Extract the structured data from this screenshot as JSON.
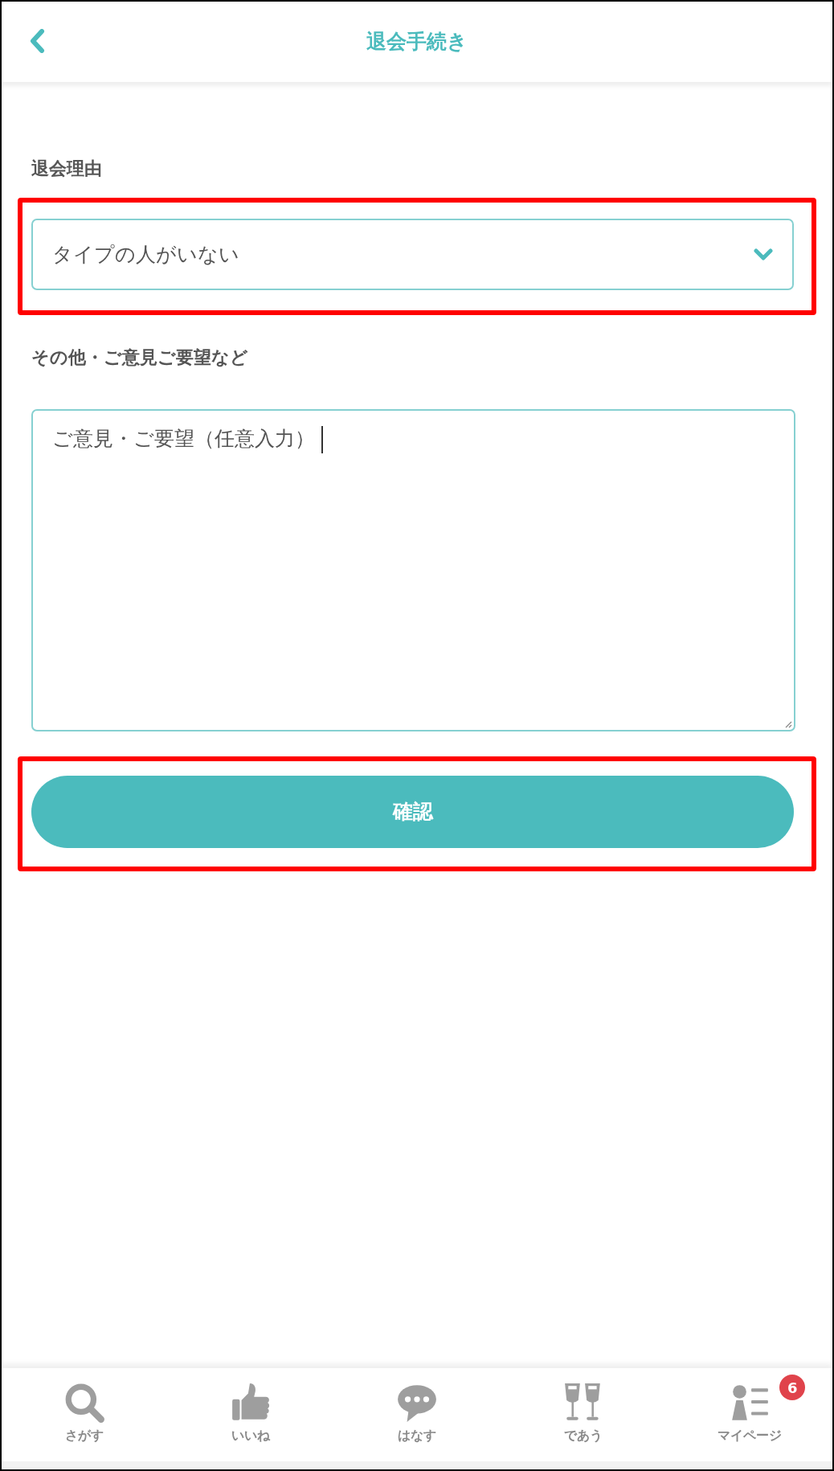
{
  "header": {
    "title": "退会手続き"
  },
  "form": {
    "reason": {
      "label": "退会理由",
      "value": "タイプの人がいない",
      "highlighted": true
    },
    "comment": {
      "label": "その他・ご意見ご要望など",
      "value": "ご意見・ご要望（任意入力）",
      "focused": true
    },
    "confirm_button": {
      "label": "確認",
      "highlighted": true
    }
  },
  "bottom_nav": [
    {
      "kind": "search",
      "label": "さがす",
      "selected": false
    },
    {
      "kind": "like",
      "label": "いいね",
      "selected": false
    },
    {
      "kind": "talk",
      "label": "はなす",
      "selected": false
    },
    {
      "kind": "meet",
      "label": "であう",
      "selected": false
    },
    {
      "kind": "mypage",
      "label": "マイページ",
      "selected": false,
      "badge": "6"
    }
  ]
}
